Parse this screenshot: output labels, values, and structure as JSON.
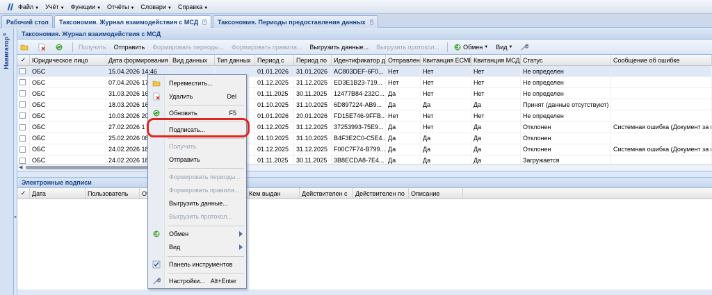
{
  "menubar": {
    "items": [
      "Файл",
      "Учёт",
      "Функции",
      "Отчёты",
      "Словари",
      "Справка"
    ]
  },
  "tabs": [
    {
      "label": "Рабочий стол"
    },
    {
      "label": "Таксономия. Журнал взаимодействия с МСД"
    },
    {
      "label": "Таксономия. Периоды предоставления данных"
    }
  ],
  "sidebar": {
    "label": "Навигатор"
  },
  "panel": {
    "title": "Таксономия. Журнал взаимодействия с МСД"
  },
  "toolbar": {
    "get": "Получить",
    "send": "Отправить",
    "form_periods": "Формировать периоды...",
    "form_rules": "Формировать правила...",
    "export_data": "Выгрузить данные...",
    "export_protocol": "Выгрузить протокол...",
    "exchange": "Обмен",
    "view": "Вид"
  },
  "grid": {
    "columns": [
      "Юридическое лицо",
      "Дата формирования",
      "Вид данных",
      "Тип данных",
      "Период с",
      "Период по",
      "Идентификатор до",
      "Отправлен",
      "Квитанция ЕСМВ",
      "Квитанция МСД",
      "Статус",
      "Сообщение об ошибке"
    ],
    "rows": [
      [
        "ОБС",
        "15.04.2026 14:46",
        "",
        "",
        "01.01.2026",
        "31.01.2026",
        "AC803DEF-6F0...",
        "Нет",
        "Нет",
        "Нет",
        "Не определен",
        ""
      ],
      [
        "ОБС",
        "07.04.2026 17",
        "",
        "",
        "01.12.2025",
        "31.12.2025",
        "ED3E1B23-719...",
        "Нет",
        "Нет",
        "Нет",
        "Не определен",
        ""
      ],
      [
        "ОБС",
        "31.03.2026 16",
        "",
        "",
        "01.11.2025",
        "30.11.2025",
        "12477B84-232C...",
        "Да",
        "Нет",
        "Нет",
        "Не определен",
        ""
      ],
      [
        "ОБС",
        "18.03.2026 16",
        "",
        "",
        "01.10.2025",
        "31.10.2025",
        "6D897224-AB9...",
        "Да",
        "Да",
        "Да",
        "Принят (данные отсутствуют)",
        ""
      ],
      [
        "ОБС",
        "10.03.2026 20",
        "",
        "",
        "01.01.2026",
        "20.01.2026",
        "FD15E746-9FFB...",
        "Нет",
        "Нет",
        "Нет",
        "Не определен",
        ""
      ],
      [
        "ОБС",
        "27.02.2026 1",
        "",
        "",
        "01.12.2025",
        "31.12.2025",
        "37253993-75E9...",
        "Да",
        "Нет",
        "Да",
        "Отклонен",
        "Системная ошибка (Документ за п"
      ],
      [
        "ОБС",
        "25.02.2026 08",
        "",
        "",
        "01.10.2025",
        "31.10.2025",
        "B4F3E2C0-C5E4...",
        "Да",
        "Да",
        "Да",
        "Отклонен",
        ""
      ],
      [
        "ОБС",
        "24.02.2026 18",
        "",
        "",
        "01.12.2025",
        "31.12.2025",
        "F00C7F74-B799...",
        "Да",
        "Да",
        "Да",
        "Отклонен",
        "Системная ошибка (Документ за п"
      ],
      [
        "ОБС",
        "24.02.2026 18",
        "",
        "",
        "01.11.2025",
        "30.11.2025",
        "3B8ECDA8-7E4...",
        "Да",
        "Да",
        "Да",
        "Загружается",
        ""
      ]
    ]
  },
  "signatures": {
    "title": "Электронные подписи",
    "columns": [
      "Дата",
      "Пользователь",
      "От",
      "Кем выдан",
      "Действителен с",
      "Действителен по",
      "Описание"
    ]
  },
  "context_menu": {
    "move": "Переместить...",
    "delete": "Удалить",
    "delete_shortcut": "Del",
    "refresh": "Обновить",
    "refresh_shortcut": "F5",
    "sign": "Подписать...",
    "get": "Получить",
    "send": "Отправить",
    "form_periods": "Формировать периоды...",
    "form_rules": "Формировать правила...",
    "export_data": "Выгрузить данные...",
    "export_protocol": "Выгрузить протокол...",
    "exchange": "Обмен",
    "view": "Вид",
    "toolbar_panel": "Панель инструментов",
    "settings": "Настройки...",
    "settings_shortcut": "Alt+Enter"
  }
}
